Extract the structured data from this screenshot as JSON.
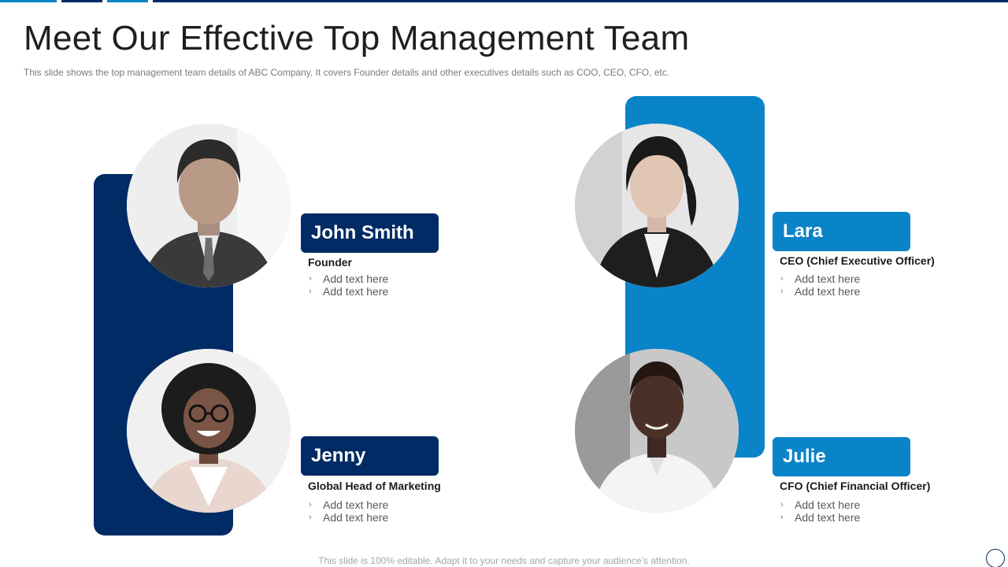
{
  "slide": {
    "title": "Meet Our Effective Top Management Team",
    "subtitle": "This slide shows the top management team details of ABC Company, It covers Founder details and other executives details such as COO, CEO, CFO, etc.",
    "footer": "This slide is 100% editable. Adapt it to your needs and capture your audience’s attention."
  },
  "colors": {
    "navy": "#002b64",
    "blue": "#0a84c8",
    "light_blue": "#1a8ad0"
  },
  "members": [
    {
      "name": "John Smith",
      "role": "Founder",
      "bullets": [
        "Add text here",
        "Add text here"
      ],
      "photo_icon": "man-suit-portrait"
    },
    {
      "name": "Lara",
      "role": "CEO (Chief Executive Officer)",
      "bullets": [
        "Add text here",
        "Add text here"
      ],
      "photo_icon": "woman-blazer-portrait"
    },
    {
      "name": "Jenny",
      "role": "Global Head of Marketing",
      "bullets": [
        "Add text here",
        "Add text here"
      ],
      "photo_icon": "woman-curly-hair-glasses-portrait"
    },
    {
      "name": "Julie",
      "role": "CFO (Chief Financial Officer)",
      "bullets": [
        "Add text here",
        "Add text here"
      ],
      "photo_icon": "woman-white-shirt-portrait"
    }
  ]
}
